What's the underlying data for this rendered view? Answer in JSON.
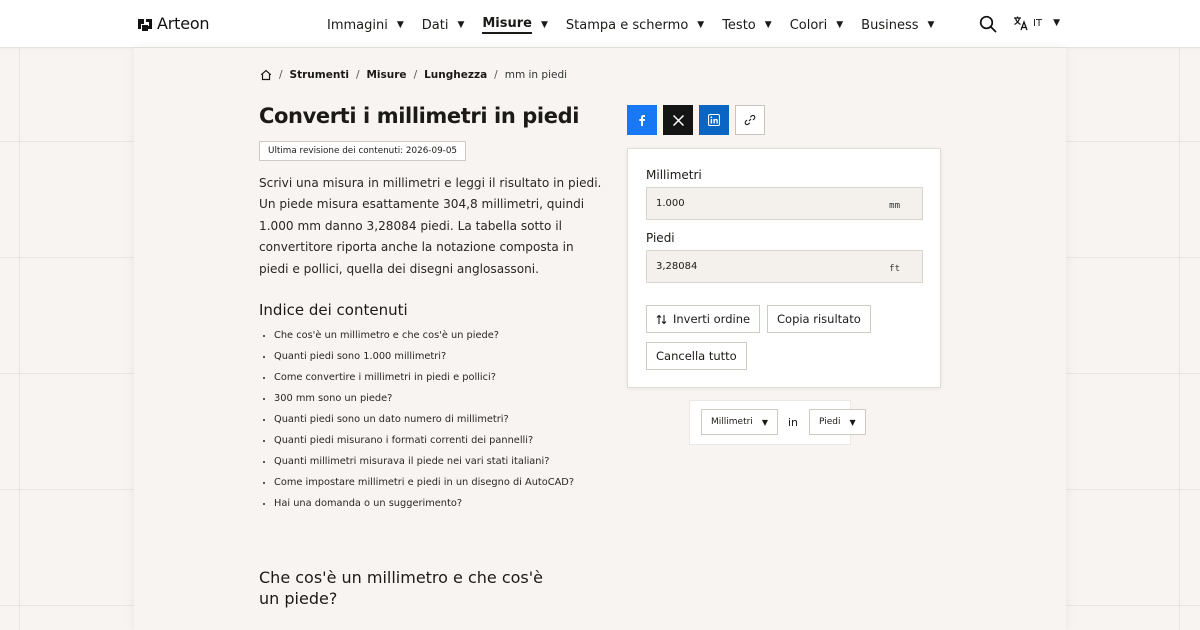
{
  "brand": {
    "name": "Arteon"
  },
  "nav": {
    "items": [
      {
        "label": "Immagini",
        "active": false
      },
      {
        "label": "Dati",
        "active": false
      },
      {
        "label": "Misure",
        "active": true
      },
      {
        "label": "Stampa e schermo",
        "active": false
      },
      {
        "label": "Testo",
        "active": false
      },
      {
        "label": "Colori",
        "active": false
      },
      {
        "label": "Business",
        "active": false
      }
    ],
    "search_icon": "search-icon",
    "language_icon": "translate-icon",
    "language": "IT"
  },
  "breadcrumb": {
    "home_icon": "home-icon",
    "items": [
      "Strumenti",
      "Misure",
      "Lunghezza"
    ],
    "current": "mm in piedi"
  },
  "page": {
    "title": "Converti i millimetri in piedi",
    "revision": "Ultima revisione dei contenuti: 2026-09-05",
    "intro": "Scrivi una misura in millimetri e leggi il risultato in piedi. Un piede misura esattamente 304,8 millimetri, quindi 1.000 mm danno 3,28084 piedi. La tabella sotto il convertitore riporta anche la notazione composta in piedi e pollici, quella dei disegni anglosassoni."
  },
  "toc": {
    "title": "Indice dei contenuti",
    "items": [
      "Che cos'è un millimetro e che cos'è un piede?",
      "Quanti piedi sono 1.000 millimetri?",
      "Come convertire i millimetri in piedi e pollici?",
      "300 mm sono un piede?",
      "Quanti piedi sono un dato numero di millimetri?",
      "Quanti piedi misurano i formati correnti dei pannelli?",
      "Quanti millimetri misurava il piede nei vari stati italiani?",
      "Come impostare millimetri e piedi in un disegno di AutoCAD?",
      "Hai una domanda o un suggerimento?"
    ]
  },
  "section": {
    "title": "Che cos'è un millimetro e che cos'è un piede?"
  },
  "share": {
    "buttons": [
      {
        "icon": "facebook-icon",
        "color": "#1877f2"
      },
      {
        "icon": "x-icon",
        "color": "#141414"
      },
      {
        "icon": "linkedin-icon",
        "color": "#0a66c2"
      },
      {
        "icon": "link-icon",
        "color": "#ffffff"
      }
    ]
  },
  "converter": {
    "from_label": "Millimetri",
    "from_value": "1.000",
    "from_unit": "mm",
    "to_label": "Piedi",
    "to_value": "3,28084",
    "to_unit": "ft",
    "swap_label": "Inverti ordine",
    "swap_icon": "swap-icon",
    "copy_label": "Copia risultato",
    "clear_label": "Cancella tutto"
  },
  "selectors": {
    "from": "Millimetri",
    "connector": "in",
    "to": "Piedi"
  },
  "colors": {
    "background": "#f7f4f1",
    "text": "#1c1a17",
    "facebook": "#1877f2",
    "x": "#141414",
    "linkedin": "#0a66c2"
  }
}
